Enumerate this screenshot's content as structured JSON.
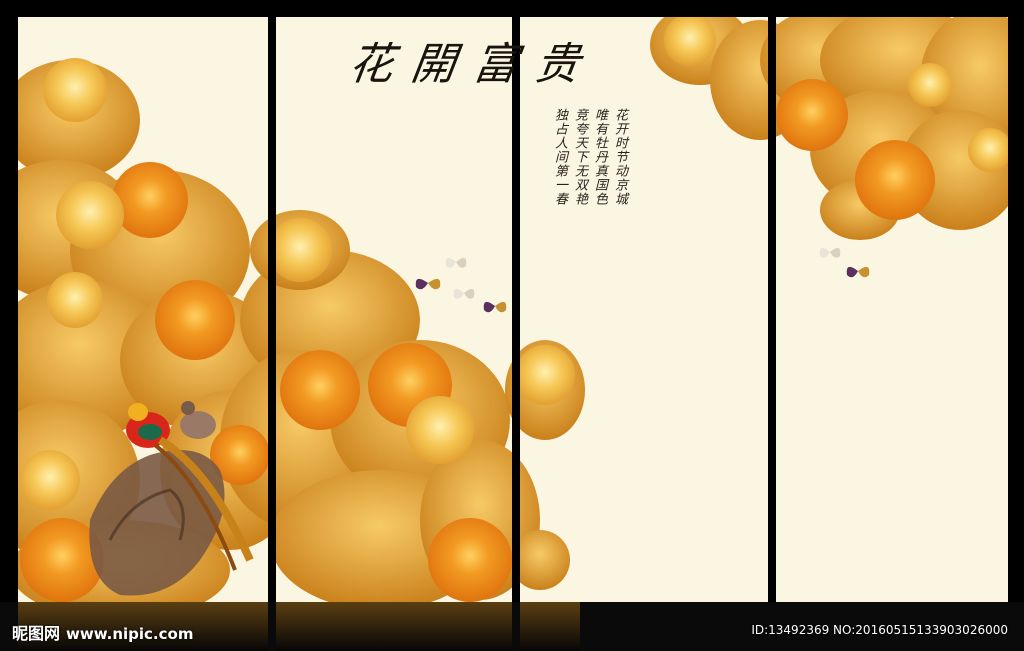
{
  "artwork": {
    "title": "花開富贵",
    "poem_lines": [
      "花开时节动京城",
      "唯有牡丹真国色",
      "竞夸天下无双艳",
      "独占人间第一春"
    ],
    "colors": {
      "background": "#fbf6e2",
      "frame": "#000000",
      "peony_orange": "#f0901a",
      "peony_gold": "#f3b43a",
      "leaf_gold": "#d98a14"
    }
  },
  "watermark": {
    "logo_text": "昵图网",
    "url": "www.nipic.com"
  },
  "photo_info": {
    "id_text": "ID:13492369 NO:20160515133903026000"
  }
}
